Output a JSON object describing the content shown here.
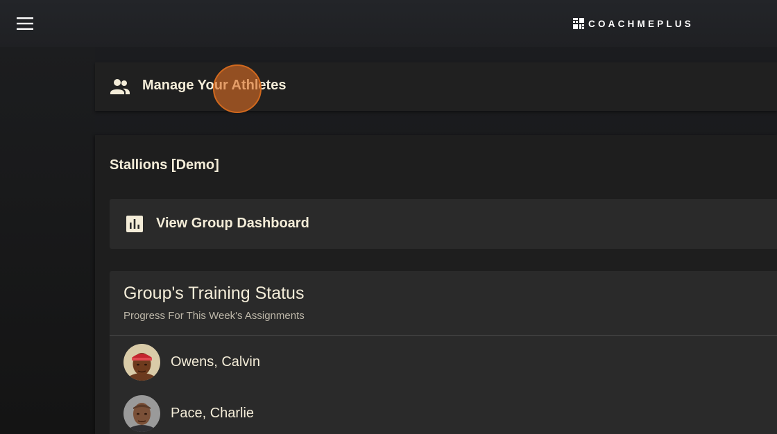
{
  "header": {
    "brand_name": "COACHMEPLUS",
    "menu_icon": "hamburger-menu-icon",
    "brand_icon": "grid-logo-icon"
  },
  "manage_card": {
    "icon": "people-icon",
    "label": "Manage Your Athletes"
  },
  "group": {
    "title": "Stallions [Demo]"
  },
  "dashboard_card": {
    "icon": "bar-chart-icon",
    "label": "View Group Dashboard"
  },
  "training_status": {
    "title": "Group's Training Status",
    "subtitle": "Progress For This Week's Assignments",
    "athletes": [
      {
        "name": "Owens, Calvin",
        "avatar": "avatar-photo"
      },
      {
        "name": "Pace, Charlie",
        "avatar": "avatar-photo"
      }
    ]
  },
  "colors": {
    "background": "#1a1a1b",
    "topbar": "#222428",
    "card": "#2a2a2a",
    "text_primary": "#f3ecd8",
    "text_secondary": "#bdb7a9",
    "click_marker": "#d2691e"
  }
}
